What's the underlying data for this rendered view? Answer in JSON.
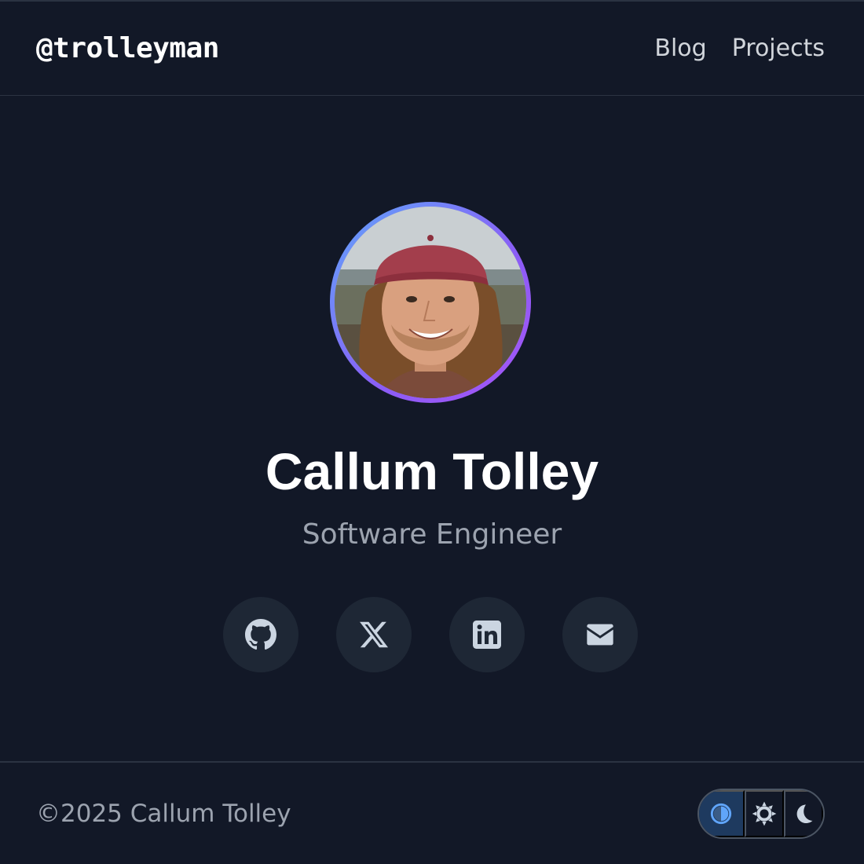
{
  "header": {
    "brand": "@trolleyman",
    "nav": [
      {
        "label": "Blog"
      },
      {
        "label": "Projects"
      }
    ]
  },
  "profile": {
    "name": "Callum Tolley",
    "role": "Software Engineer",
    "avatar_icon": "profile-photo"
  },
  "socials": [
    {
      "icon": "github-icon"
    },
    {
      "icon": "x-icon"
    },
    {
      "icon": "linkedin-icon"
    },
    {
      "icon": "mail-icon"
    }
  ],
  "footer": {
    "copyright": "©2025 Callum Tolley",
    "theme_options": [
      {
        "icon": "auto-theme-icon",
        "active": true
      },
      {
        "icon": "sun-icon",
        "active": false
      },
      {
        "icon": "moon-icon",
        "active": false
      }
    ]
  },
  "colors": {
    "background": "#121827",
    "accent_start": "#60a5fa",
    "accent_end": "#a855f7",
    "social_bg": "#1e2735"
  }
}
